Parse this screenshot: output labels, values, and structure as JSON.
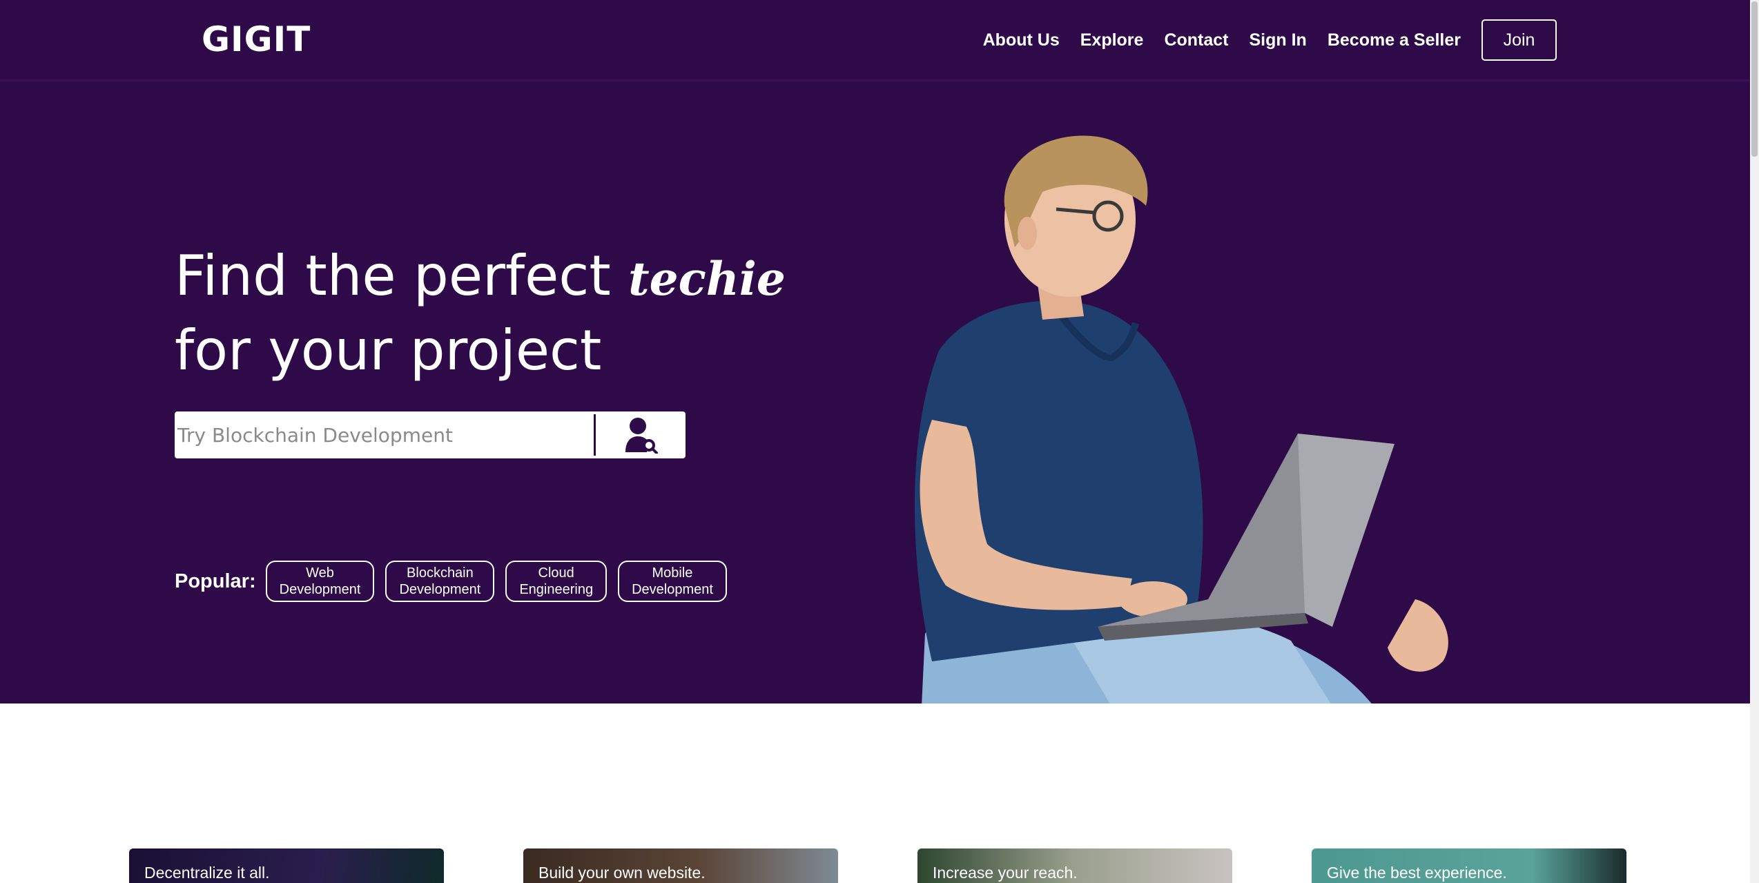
{
  "nav": {
    "logo": "GIGIT",
    "links": [
      "About Us",
      "Explore",
      "Contact",
      "Sign In",
      "Become a Seller"
    ],
    "join_label": "Join"
  },
  "hero": {
    "headline_line1": "Find the perfect",
    "headline_script": "techie",
    "headline_line2": "for your project",
    "search_placeholder": "Try Blockchain Development",
    "popular_label": "Popular:",
    "popular_tags": [
      "Web\nDevelopment",
      "Blockchain\nDevelopment",
      "Cloud\nEngineering",
      "Mobile\nDevelopment"
    ]
  },
  "cards": [
    {
      "label": "Decentralize it all."
    },
    {
      "label": "Build your own website."
    },
    {
      "label": "Increase your reach."
    },
    {
      "label": "Give the best experience."
    }
  ],
  "colors": {
    "brand": "#2f0a48",
    "text_on_brand": "#ffffff"
  },
  "icons": {
    "search_button": "user-search-icon"
  }
}
